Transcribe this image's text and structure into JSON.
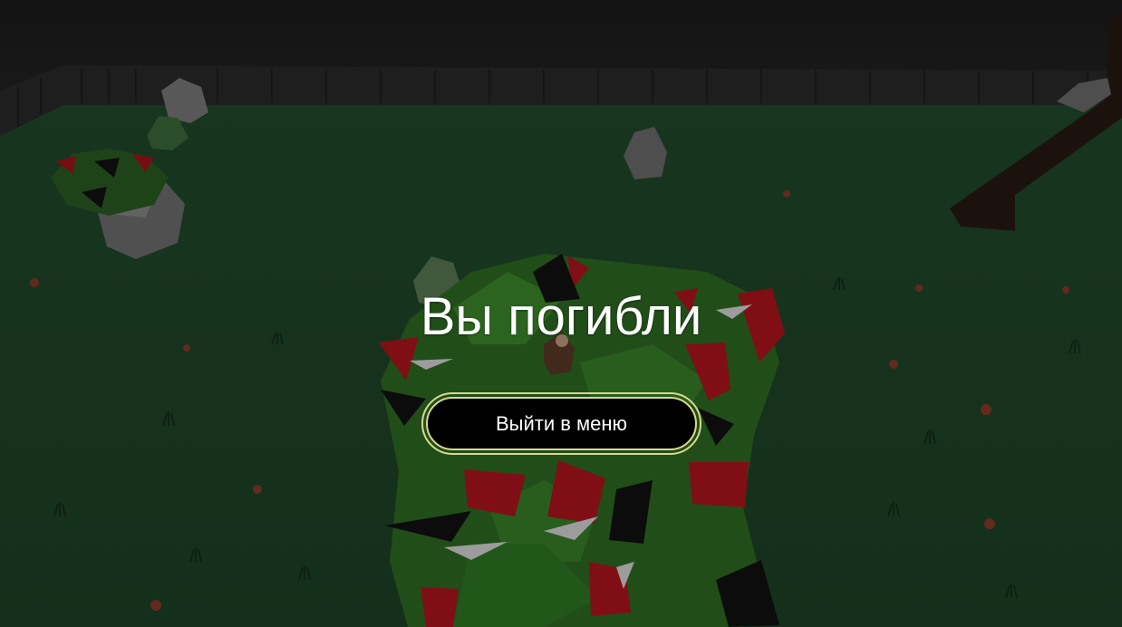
{
  "game_over": {
    "title": "Вы погибли",
    "exit_button_label": "Выйти в меню"
  },
  "colors": {
    "sky": "#1b1b1b",
    "ground": "#1f4a2a",
    "fence": "#262626",
    "bush_green": "#2f6b23",
    "thorn_red": "#b0161c",
    "button_border": "#d6d98e",
    "button_fill": "#000000",
    "text": "#ffffff"
  }
}
